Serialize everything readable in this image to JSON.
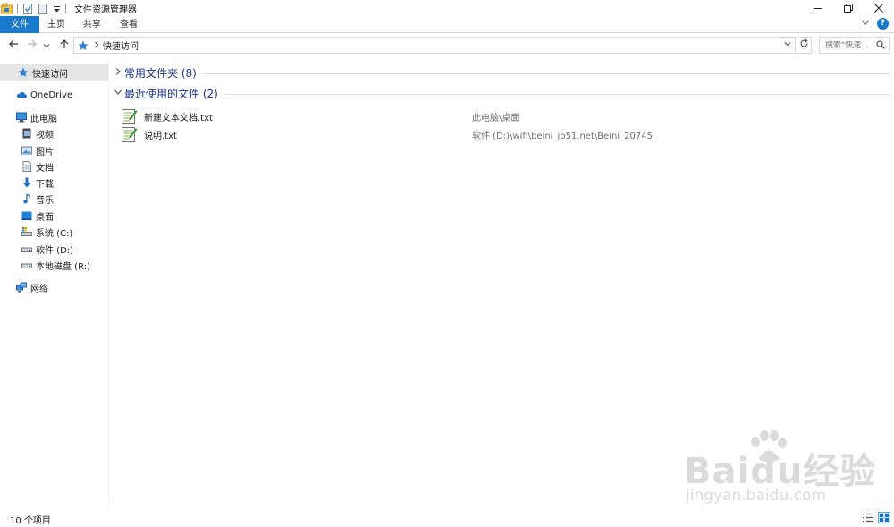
{
  "window": {
    "title": "文件资源管理器"
  },
  "ribbon": {
    "tabs": [
      "文件",
      "主页",
      "共享",
      "查看"
    ]
  },
  "address": {
    "path": "快速访问",
    "search_placeholder": "搜索\"快速..."
  },
  "sidebar": {
    "quick_access": "快速访问",
    "onedrive": "OneDrive",
    "this_pc": "此电脑",
    "pc_items": [
      {
        "label": "视频",
        "icon": "video-icon"
      },
      {
        "label": "图片",
        "icon": "picture-icon"
      },
      {
        "label": "文档",
        "icon": "document-icon"
      },
      {
        "label": "下载",
        "icon": "download-icon"
      },
      {
        "label": "音乐",
        "icon": "music-icon"
      },
      {
        "label": "桌面",
        "icon": "desktop-icon"
      },
      {
        "label": "系统 (C:)",
        "icon": "drive-icon"
      },
      {
        "label": "软件 (D:)",
        "icon": "drive-icon"
      },
      {
        "label": "本地磁盘 (R:)",
        "icon": "drive-icon"
      }
    ],
    "network": "网络"
  },
  "main": {
    "groups": [
      {
        "title": "常用文件夹 (8)",
        "expanded": false
      },
      {
        "title": "最近使用的文件 (2)",
        "expanded": true
      }
    ],
    "recent_files": [
      {
        "name": "新建文本文档.txt",
        "location": "此电脑\\桌面"
      },
      {
        "name": "说明.txt",
        "location": "软件 (D:)\\wifi\\beini_jb51.net\\Beini_20745"
      }
    ]
  },
  "status": {
    "item_count": "10 个项目"
  },
  "watermark": {
    "main": "Baidu经验",
    "sub": "jingyan.baidu.com"
  },
  "colors": {
    "accent": "#1979ca",
    "group_title": "#1e3287",
    "selection": "#e5e5e5"
  }
}
